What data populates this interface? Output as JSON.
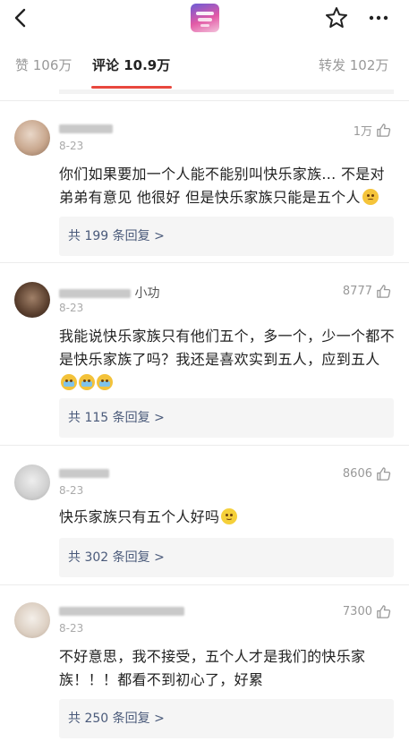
{
  "nav": {
    "back_icon": "chevron-left-icon",
    "logo_icon": "show-logo-icon",
    "star_icon": "star-outline-icon",
    "more_icon": "more-dots-icon"
  },
  "tabs": {
    "likes": "赞 106万",
    "comments": "评论 10.9万",
    "reposts": "转发 102万",
    "active_color": "#e8483e"
  },
  "comments": [
    {
      "username": "",
      "date": "8-23",
      "likes": "1万",
      "text": "你们如果要加一个人能不能别叫快乐家族... 不是对弟弟有意见 他很好 但是快乐家族只能是五个人",
      "emoji": "sad",
      "replies": "共 199 条回复 >"
    },
    {
      "username": "小功",
      "date": "8-23",
      "likes": "8777",
      "text": "我能说快乐家族只有他们五个，多一个，少一个都不是快乐家族了吗？我还是喜欢实到五人，应到五人",
      "emoji": "cry3",
      "replies": "共 115 条回复 >"
    },
    {
      "username": "",
      "date": "8-23",
      "likes": "8606",
      "text": "快乐家族只有五个人好吗",
      "emoji": "smile",
      "replies": "共 302 条回复 >"
    },
    {
      "username": "",
      "date": "8-23",
      "likes": "7300",
      "text": "不好意思，我不接受，五个人才是我们的快乐家族！！！都看不到初心了，好累",
      "emoji": "",
      "replies": "共 250 条回复 >"
    }
  ]
}
